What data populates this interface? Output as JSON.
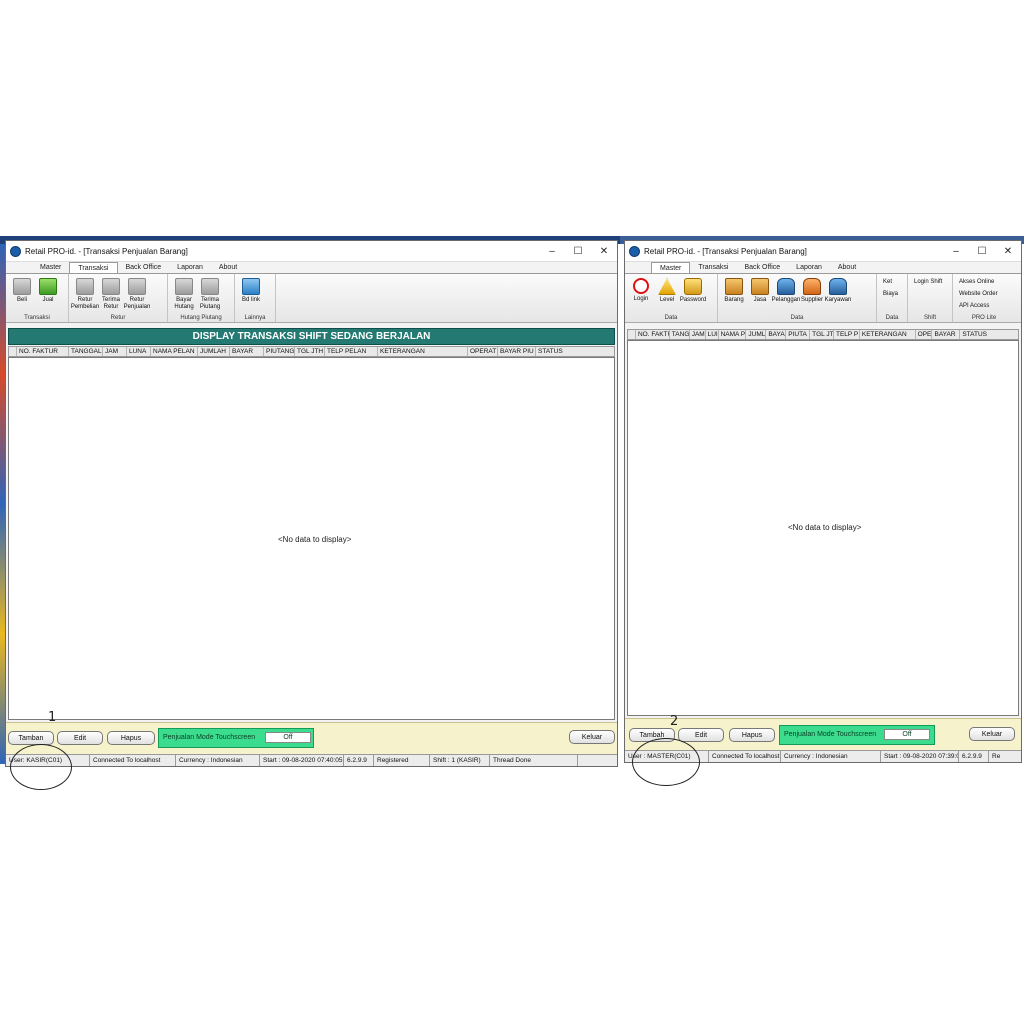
{
  "left": {
    "title": "Retail PRO-id. - [Transaksi Penjualan Barang]",
    "menu": [
      "Master",
      "Transaksi",
      "Back Office",
      "Laporan",
      "About"
    ],
    "ribbon": {
      "groups": [
        {
          "label": "Transaksi",
          "items": [
            "Beli",
            "Jual"
          ]
        },
        {
          "label": "Retur",
          "items": [
            "Retur Pembelian",
            "Terima Retur",
            "Retur Penjualan"
          ]
        },
        {
          "label": "Hutang Piutang",
          "items": [
            "Bayar Hutang",
            "Terima Piutang"
          ]
        },
        {
          "label": "Lainnya",
          "items": [
            "Bd link"
          ]
        }
      ]
    },
    "panel_title": "DISPLAY TRANSAKSI SHIFT SEDANG BERJALAN",
    "columns": [
      "NO. FAKTUR",
      "TANGGAL",
      "JAM",
      "LUNA",
      "NAMA PELAN",
      "JUMLAH",
      "BAYAR",
      "PIUTANG",
      "TGL JTH TE",
      "TELP PELAN",
      "KETERANGAN",
      "OPERAT",
      "BAYAR PIU",
      "STATUS"
    ],
    "empty_text": "<No data to display>",
    "buttons": {
      "add": "Tamban",
      "edit": "Edit",
      "delete": "Hapus",
      "exit": "Keluar"
    },
    "touch_label": "Penjualan Mode Touchscreen",
    "touch_value": "Off",
    "status": [
      "User: KASIR(C01)",
      "Connected To localhost",
      "Currency : Indonesian",
      "Start : 09-08-2020 07:40:05",
      "6.2.9.9",
      "Registered",
      "Shift : 1 (KASIR)",
      "Thread Done"
    ]
  },
  "right": {
    "title": "Retail PRO-id. - [Transaksi Penjualan Barang]",
    "menu": [
      "Master",
      "Transaksi",
      "Back Office",
      "Laporan",
      "About"
    ],
    "ribbon": {
      "groups": [
        {
          "label": "Data",
          "items": [
            "Login",
            "Level",
            "Password"
          ]
        },
        {
          "label": "Data",
          "items": [
            "Barang",
            "Jasa",
            "Pelanggan",
            "Supplier",
            "Karyawan"
          ]
        },
        {
          "label": "Data",
          "items": [
            "Ket",
            "Biaya"
          ]
        },
        {
          "label": "Shift",
          "items": [
            "Login Shift"
          ]
        },
        {
          "label": "PRO Lite",
          "items": [
            "Akses Online",
            "Website Order",
            "API Access"
          ]
        }
      ]
    },
    "columns": [
      "NO. FAKTU",
      "TANG",
      "JAM",
      "LUI",
      "NAMA P",
      "JUML",
      "BAYA",
      "PIUTA",
      "TGL JT",
      "TELP P",
      "KETERANGAN",
      "OPE",
      "BAYAR",
      "STATUS"
    ],
    "empty_text": "<No data to display>",
    "buttons": {
      "add": "Tambah",
      "edit": "Edit",
      "delete": "Hapus",
      "exit": "Keluar"
    },
    "touch_label": "Penjualan Mode Touchscreen",
    "touch_value": "Off",
    "status": [
      "User : MASTER(C01)",
      "Connected To localhost",
      "Currency : Indonesian",
      "Start : 09-08-2020 07:39:06",
      "6.2.9.9",
      "Re"
    ]
  },
  "annotations": {
    "mark1": "1",
    "mark2": "2"
  },
  "colors": {
    "panel_header": "#247a73",
    "touch_bg": "#3cdc8e",
    "button_bar": "#f6f2cc"
  }
}
